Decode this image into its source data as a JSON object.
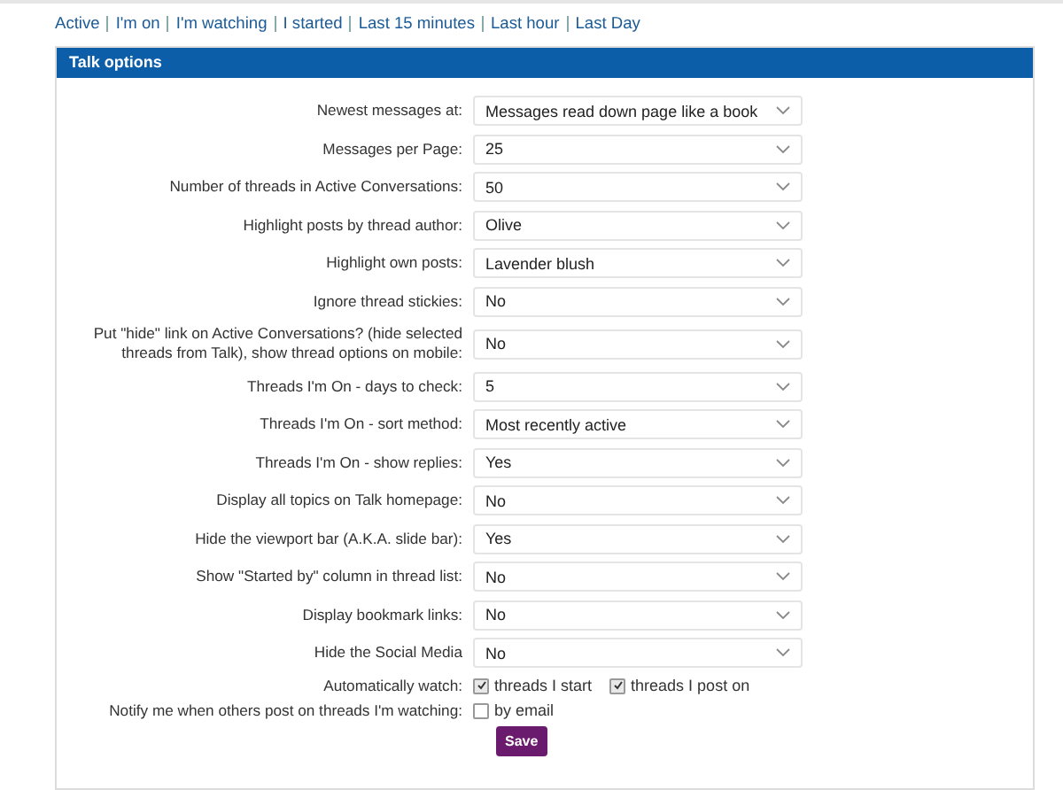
{
  "nav": [
    {
      "label": "Active",
      "selected": false
    },
    {
      "label": "I'm on",
      "selected": false
    },
    {
      "label": "I'm watching",
      "selected": false
    },
    {
      "label": "I started",
      "selected": false
    },
    {
      "label": "Last 15 minutes",
      "selected": false
    },
    {
      "label": "Last hour",
      "selected": false
    },
    {
      "label": "Last Day",
      "selected": false
    }
  ],
  "panel": {
    "title": "Talk options"
  },
  "rows": [
    {
      "kind": "select",
      "label": "Newest messages at:",
      "value": "Messages read down page like a book"
    },
    {
      "kind": "select",
      "label": "Messages per Page:",
      "value": "25"
    },
    {
      "kind": "select",
      "label": "Number of threads in Active Conversations:",
      "value": "50"
    },
    {
      "kind": "select",
      "label": "Highlight posts by thread author:",
      "value": "Olive"
    },
    {
      "kind": "select",
      "label": "Highlight own posts:",
      "value": "Lavender blush"
    },
    {
      "kind": "select",
      "label": "Ignore thread stickies:",
      "value": "No"
    },
    {
      "kind": "select",
      "label": "Put \"hide\" link on Active Conversations? (hide selected threads from Talk), show thread options on mobile:",
      "value": "No"
    },
    {
      "kind": "select",
      "label": "Threads I'm On - days to check:",
      "value": "5"
    },
    {
      "kind": "select",
      "label": "Threads I'm On - sort method:",
      "value": "Most recently active"
    },
    {
      "kind": "select",
      "label": "Threads I'm On - show replies:",
      "value": "Yes"
    },
    {
      "kind": "select",
      "label": "Display all topics on Talk homepage:",
      "value": "No"
    },
    {
      "kind": "select",
      "label": "Hide the viewport bar (A.K.A. slide bar):",
      "value": "Yes"
    },
    {
      "kind": "select",
      "label": "Show \"Started by\" column in thread list:",
      "value": "No"
    },
    {
      "kind": "select",
      "label": "Display bookmark links:",
      "value": "No"
    },
    {
      "kind": "select",
      "label": "Hide the Social Media",
      "value": "No"
    },
    {
      "kind": "checkboxes",
      "label": "Automatically watch:",
      "options": [
        {
          "label": "threads I start",
          "checked": true
        },
        {
          "label": "threads I post on",
          "checked": true
        }
      ]
    },
    {
      "kind": "checkboxes",
      "label": "Notify me when others post on threads I'm watching:",
      "options": [
        {
          "label": "by email",
          "checked": false
        }
      ]
    }
  ],
  "save_button": "Save"
}
